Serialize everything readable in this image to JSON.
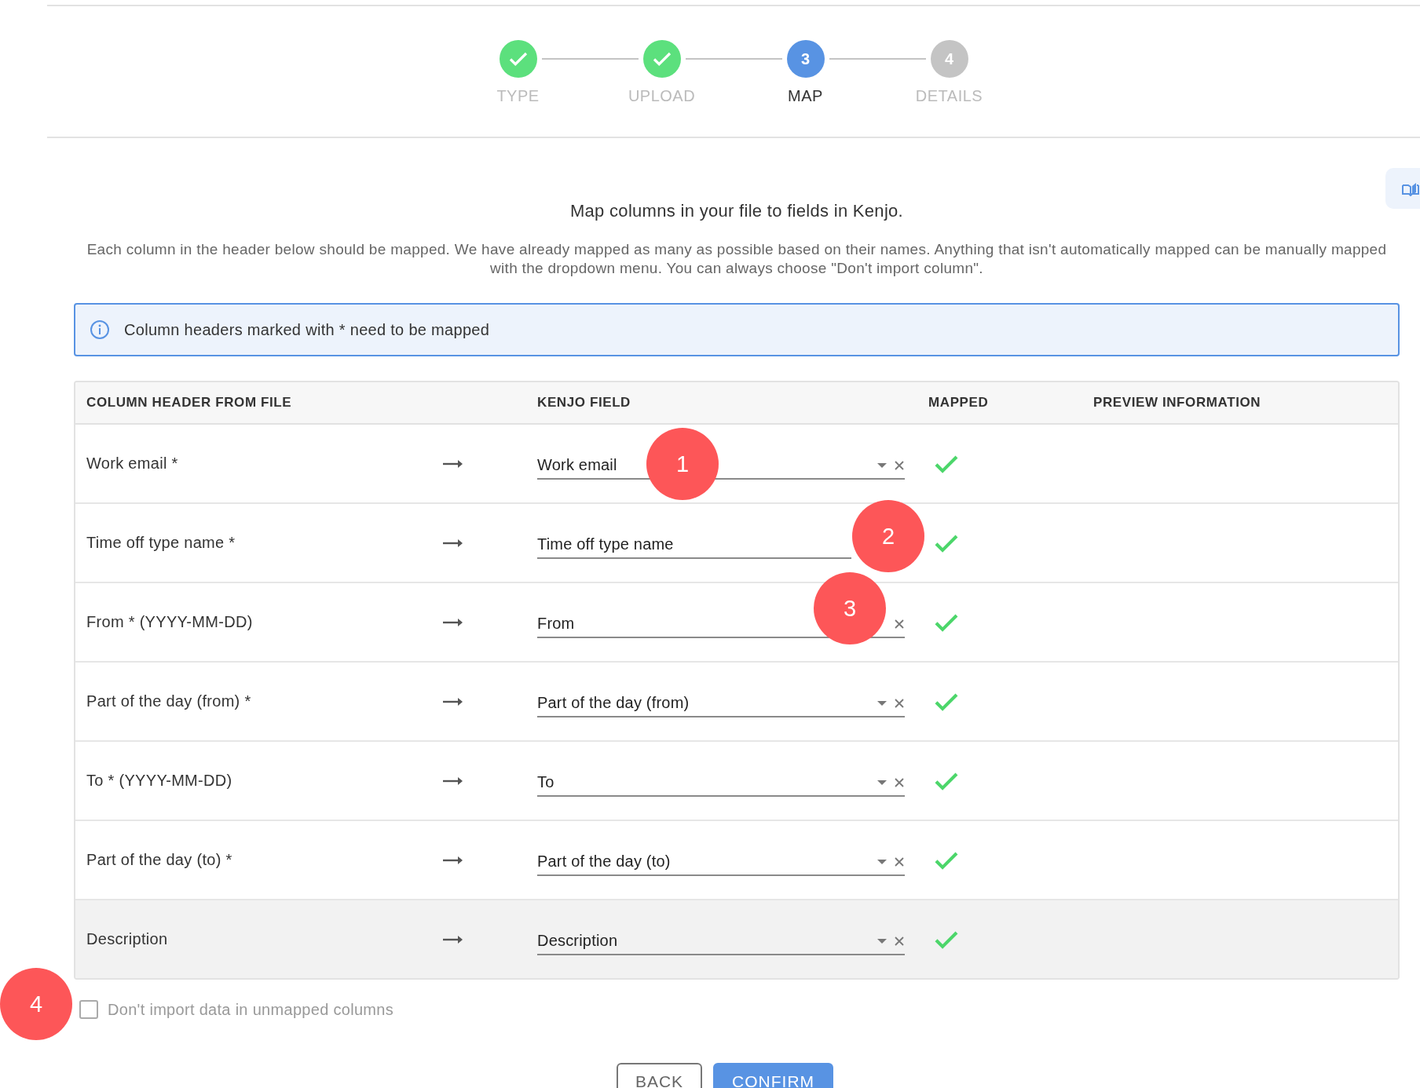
{
  "stepper": [
    {
      "label": "TYPE",
      "kind": "done"
    },
    {
      "label": "UPLOAD",
      "kind": "done"
    },
    {
      "number": "3",
      "label": "MAP",
      "kind": "current"
    },
    {
      "number": "4",
      "label": "DETAILS",
      "kind": "pending"
    }
  ],
  "title": "Map columns in your file to fields in Kenjo.",
  "description": "Each column in the header below should be mapped. We have already mapped as many as possible based on their names. Anything that isn't automatically mapped can be manually mapped with the dropdown menu. You can always choose \"Don't import column\".",
  "info_banner": "Column headers marked with * need to be mapped",
  "table": {
    "columns": [
      "COLUMN HEADER FROM FILE",
      "KENJO FIELD",
      "MAPPED",
      "PREVIEW INFORMATION"
    ],
    "rows": [
      {
        "header": "Work email *",
        "field": "Work email",
        "caret": true,
        "clear": true,
        "mapped": true,
        "hovered": false
      },
      {
        "header": "Time off type name *",
        "field": "Time off type name",
        "caret": false,
        "clear": false,
        "mapped": true,
        "hovered": false
      },
      {
        "header": "From * (YYYY-MM-DD)",
        "field": "From",
        "caret": false,
        "clear": true,
        "mapped": true,
        "hovered": false
      },
      {
        "header": "Part of the day (from) *",
        "field": "Part of the day (from)",
        "caret": true,
        "clear": true,
        "mapped": true,
        "hovered": false
      },
      {
        "header": "To * (YYYY-MM-DD)",
        "field": "To",
        "caret": true,
        "clear": true,
        "mapped": true,
        "hovered": false
      },
      {
        "header": "Part of the day (to) *",
        "field": "Part of the day (to)",
        "caret": true,
        "clear": true,
        "mapped": true,
        "hovered": false
      },
      {
        "header": "Description",
        "field": "Description",
        "caret": true,
        "clear": true,
        "mapped": true,
        "hovered": true
      }
    ]
  },
  "skip_unmapped": {
    "label": "Don't import data in unmapped columns",
    "checked": false
  },
  "buttons": [
    {
      "label": "BACK",
      "kind": "secondary"
    },
    {
      "label": "CONFIRM",
      "kind": "primary"
    }
  ],
  "annotations": [
    "1",
    "2",
    "3",
    "4"
  ]
}
